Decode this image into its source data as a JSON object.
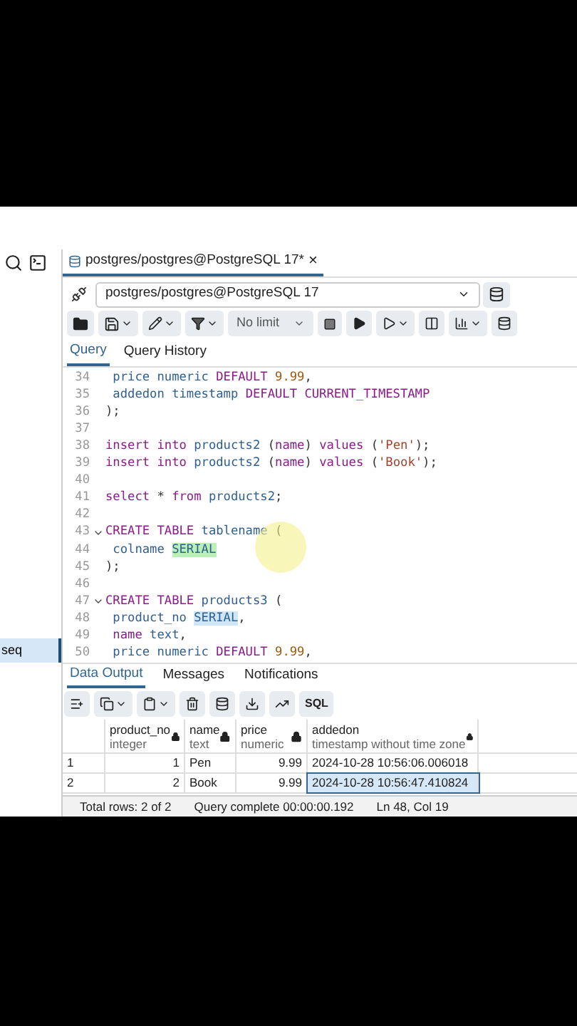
{
  "sidebar": {
    "items": [
      {
        "label": "seq",
        "selected": true
      }
    ]
  },
  "editor_tab": {
    "title": "postgres/postgres@PostgreSQL 17*",
    "close": "×"
  },
  "connection": {
    "value": "postgres/postgres@PostgreSQL 17"
  },
  "toolbar": {
    "limit": "No limit"
  },
  "query_tabs": [
    {
      "label": "Query",
      "selected": true
    },
    {
      "label": "Query History",
      "selected": false
    }
  ],
  "code_lines": [
    {
      "number": "34",
      "fold": false,
      "tokens": [
        {
          "kind": "ident",
          "text": " price numeric "
        },
        {
          "kind": "kw",
          "text": "DEFAULT "
        },
        {
          "kind": "num",
          "text": "9.99"
        },
        {
          "kind": "plain",
          "text": ","
        }
      ]
    },
    {
      "number": "35",
      "fold": false,
      "tokens": [
        {
          "kind": "ident",
          "text": " addedon timestamp "
        },
        {
          "kind": "kw",
          "text": "DEFAULT CURRENT_TIMESTAMP"
        }
      ]
    },
    {
      "number": "36",
      "fold": false,
      "tokens": [
        {
          "kind": "plain",
          "text": ");"
        }
      ]
    },
    {
      "number": "37",
      "fold": false
    },
    {
      "number": "38",
      "fold": false,
      "tokens": [
        {
          "kind": "kw",
          "text": "insert into "
        },
        {
          "kind": "ident",
          "text": "products2 "
        },
        {
          "kind": "plain",
          "text": "("
        },
        {
          "kind": "kw",
          "text": "name"
        },
        {
          "kind": "plain",
          "text": ") "
        },
        {
          "kind": "kw",
          "text": "values "
        },
        {
          "kind": "plain",
          "text": "("
        },
        {
          "kind": "str",
          "text": "'Pen'"
        },
        {
          "kind": "plain",
          "text": ");"
        }
      ]
    },
    {
      "number": "39",
      "fold": false,
      "tokens": [
        {
          "kind": "kw",
          "text": "insert into "
        },
        {
          "kind": "ident",
          "text": "products2 "
        },
        {
          "kind": "plain",
          "text": "("
        },
        {
          "kind": "kw",
          "text": "name"
        },
        {
          "kind": "plain",
          "text": ") "
        },
        {
          "kind": "kw",
          "text": "values "
        },
        {
          "kind": "plain",
          "text": "("
        },
        {
          "kind": "str",
          "text": "'Book'"
        },
        {
          "kind": "plain",
          "text": ");"
        }
      ]
    },
    {
      "number": "40",
      "fold": false
    },
    {
      "number": "41",
      "fold": false,
      "tokens": [
        {
          "kind": "kw",
          "text": "select "
        },
        {
          "kind": "plain",
          "text": "* "
        },
        {
          "kind": "kw",
          "text": "from "
        },
        {
          "kind": "ident",
          "text": "products2"
        },
        {
          "kind": "plain",
          "text": ";"
        }
      ]
    },
    {
      "number": "42",
      "fold": false
    },
    {
      "number": "43",
      "fold": true,
      "tokens": [
        {
          "kind": "kw",
          "text": "CREATE TABLE "
        },
        {
          "kind": "ident",
          "text": "tablename "
        },
        {
          "kind": "plain",
          "text": "("
        }
      ]
    },
    {
      "number": "44",
      "fold": false,
      "tokens": [
        {
          "kind": "ident",
          "text": " colname "
        },
        {
          "kind": "match",
          "text": "SERIAL"
        }
      ]
    },
    {
      "number": "45",
      "fold": false,
      "tokens": [
        {
          "kind": "plain",
          "text": ");"
        }
      ]
    },
    {
      "number": "46",
      "fold": false
    },
    {
      "number": "47",
      "fold": true,
      "tokens": [
        {
          "kind": "kw",
          "text": "CREATE TABLE "
        },
        {
          "kind": "ident",
          "text": "products3 "
        },
        {
          "kind": "plain",
          "text": "("
        }
      ]
    },
    {
      "number": "48",
      "fold": false,
      "tokens": [
        {
          "kind": "ident",
          "text": " product_no "
        },
        {
          "kind": "sel",
          "text": "SERIAL"
        },
        {
          "kind": "plain",
          "text": ","
        }
      ]
    },
    {
      "number": "49",
      "fold": false,
      "tokens": [
        {
          "kind": "kw",
          "text": " name "
        },
        {
          "kind": "ident",
          "text": "text"
        },
        {
          "kind": "plain",
          "text": ","
        }
      ]
    },
    {
      "number": "50",
      "fold": false,
      "tokens": [
        {
          "kind": "ident",
          "text": " price numeric "
        },
        {
          "kind": "kw",
          "text": "DEFAULT "
        },
        {
          "kind": "num",
          "text": "9.99"
        },
        {
          "kind": "plain",
          "text": ","
        }
      ]
    }
  ],
  "output_tabs": [
    {
      "label": "Data Output",
      "selected": true
    },
    {
      "label": "Messages",
      "selected": false
    },
    {
      "label": "Notifications",
      "selected": false
    }
  ],
  "output_toolbar": {
    "sql_label": "SQL"
  },
  "table": {
    "columns": [
      {
        "name": "product_no",
        "type": "integer",
        "kind": "number"
      },
      {
        "name": "name",
        "type": "text",
        "kind": "text"
      },
      {
        "name": "price",
        "type": "numeric",
        "kind": "number"
      },
      {
        "name": "addedon",
        "type": "timestamp without time zone",
        "kind": "text"
      }
    ],
    "rows": [
      {
        "index": "1",
        "cells": [
          {
            "text": "1",
            "selected": false
          },
          {
            "text": "Pen",
            "selected": false
          },
          {
            "text": "9.99",
            "selected": false
          },
          {
            "text": "2024-10-28 10:56:06.006018",
            "selected": false
          }
        ]
      },
      {
        "index": "2",
        "cells": [
          {
            "text": "2",
            "selected": false
          },
          {
            "text": "Book",
            "selected": false
          },
          {
            "text": "9.99",
            "selected": false
          },
          {
            "text": "2024-10-28 10:56:47.410824",
            "selected": true
          }
        ]
      }
    ]
  },
  "status_bar": {
    "rows": "Total rows: 2 of 2",
    "query": "Query complete 00:00:00.192",
    "position": "Ln 48, Col 19"
  }
}
